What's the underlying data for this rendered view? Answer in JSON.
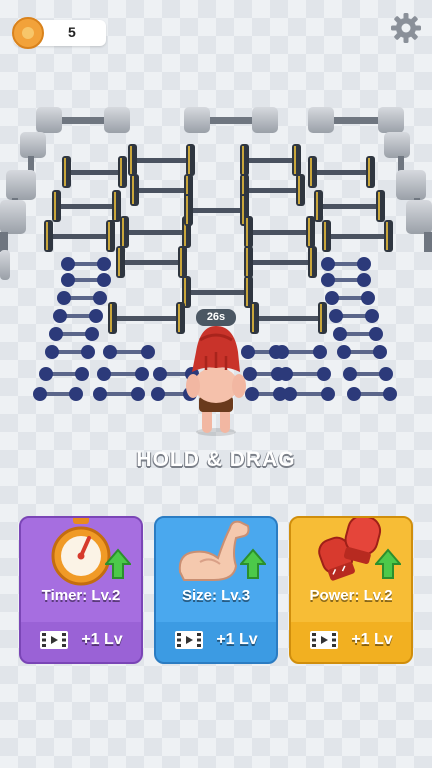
{
  "hud": {
    "coins": "5"
  },
  "timer": {
    "badge": "26s"
  },
  "hint": "HOLD & DRAG",
  "cards": [
    {
      "label": "Timer: Lv.2",
      "upgrade": "+1 Lv",
      "color": "#9a62d6"
    },
    {
      "label": "Size: Lv.3",
      "upgrade": "+1 Lv",
      "color": "#3c9be3"
    },
    {
      "label": "Power: Lv.2",
      "upgrade": "+1 Lv",
      "color": "#f2b021"
    }
  ],
  "icons": {
    "coin": "coin-icon",
    "settings": "gear-icon",
    "card_icons": [
      "stopwatch-icon",
      "flexed-arm-icon",
      "boxing-gloves-icon"
    ],
    "upgrade": "green-arrow-up-icon",
    "video": "video-ad-icon"
  }
}
